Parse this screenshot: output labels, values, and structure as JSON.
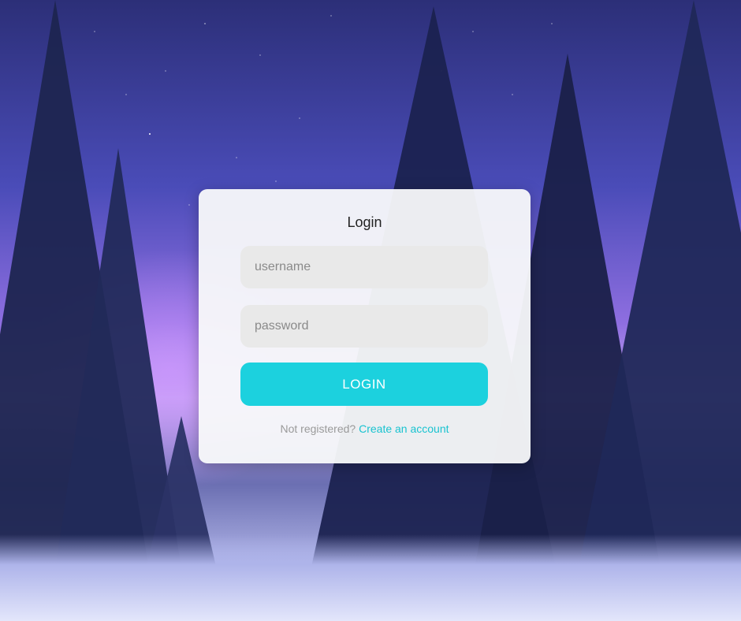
{
  "background": {
    "image": "snowy-forest-night-sky"
  },
  "login": {
    "title": "Login",
    "username_placeholder": "username",
    "password_placeholder": "password",
    "submit_label": "LOGIN",
    "register_prompt": "Not registered?",
    "register_link": "Create an account"
  },
  "colors": {
    "accent": "#1cd1de",
    "link": "#19c3d0",
    "card": "#f8f9fa",
    "field": "#e9e9e9"
  }
}
